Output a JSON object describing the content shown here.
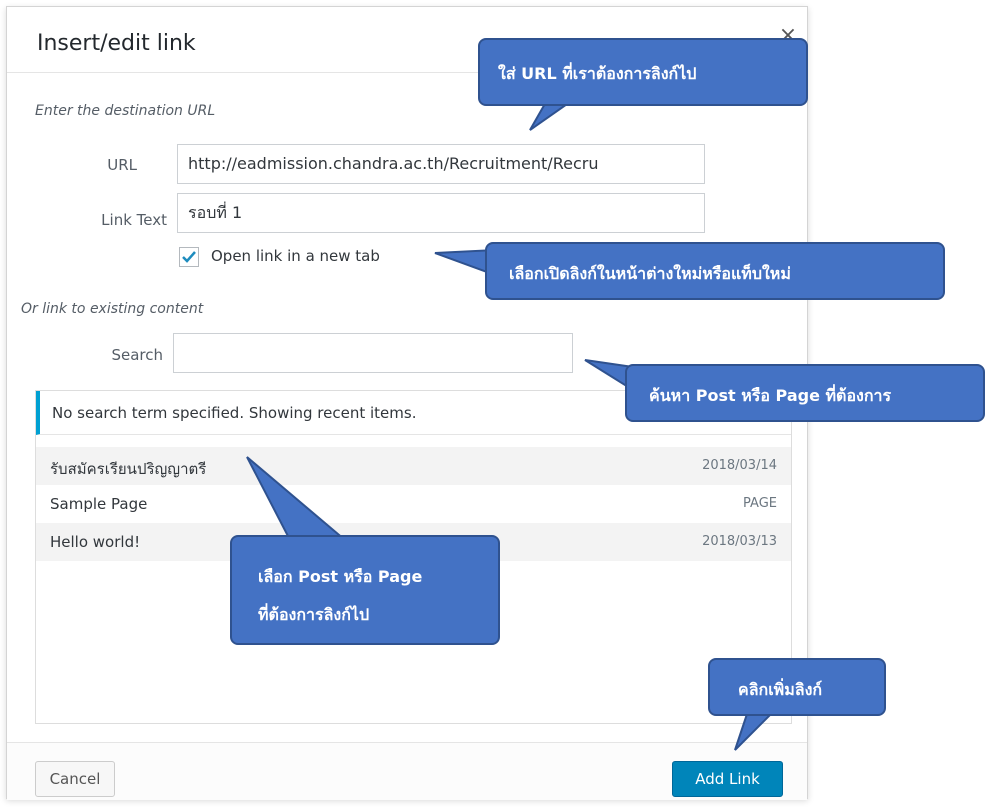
{
  "dialog": {
    "title": "Insert/edit link",
    "close_icon": "×",
    "destination_label": "Enter the destination URL",
    "url_label": "URL",
    "url_value": "http://eadmission.chandra.ac.th/Recruitment/Recru",
    "link_text_label": "Link Text",
    "link_text_value": "รอบที่ 1",
    "new_tab_label": "Open link in a new tab",
    "new_tab_checked": true,
    "existing_label": "Or link to existing content",
    "search_label": "Search",
    "search_value": "",
    "notice": "No search term specified. Showing recent items.",
    "results": [
      {
        "title": "รับสมัครเรียนปริญญาตรี",
        "info": "2018/03/14"
      },
      {
        "title": "Sample Page",
        "info": "PAGE"
      },
      {
        "title": "Hello world!",
        "info": "2018/03/13"
      }
    ],
    "cancel_label": "Cancel",
    "add_label": "Add Link"
  },
  "callouts": {
    "url": {
      "pre": "ใส่ ",
      "bold": "URL",
      "post": " ที่เราต้องการลิงก์ไป"
    },
    "new_tab": "เลือกเปิดลิงก์ในหน้าต่างใหม่หรือแท็บใหม่",
    "search": {
      "pre": "ค้นหา ",
      "b1": "Post",
      "mid": " หรือ ",
      "b2": "Page",
      "post": " ที่ต้องการ"
    },
    "select": {
      "pre": "เลือก ",
      "b1": "Post",
      "mid": " หรือ ",
      "b2": "Page",
      "line2": "ที่ต้องการลิงก์ไป"
    },
    "add": "คลิกเพิ่มลิงก์"
  },
  "colors": {
    "accent": "#0085ba",
    "callout": "#4472c4",
    "notice_border": "#00a0d2"
  }
}
